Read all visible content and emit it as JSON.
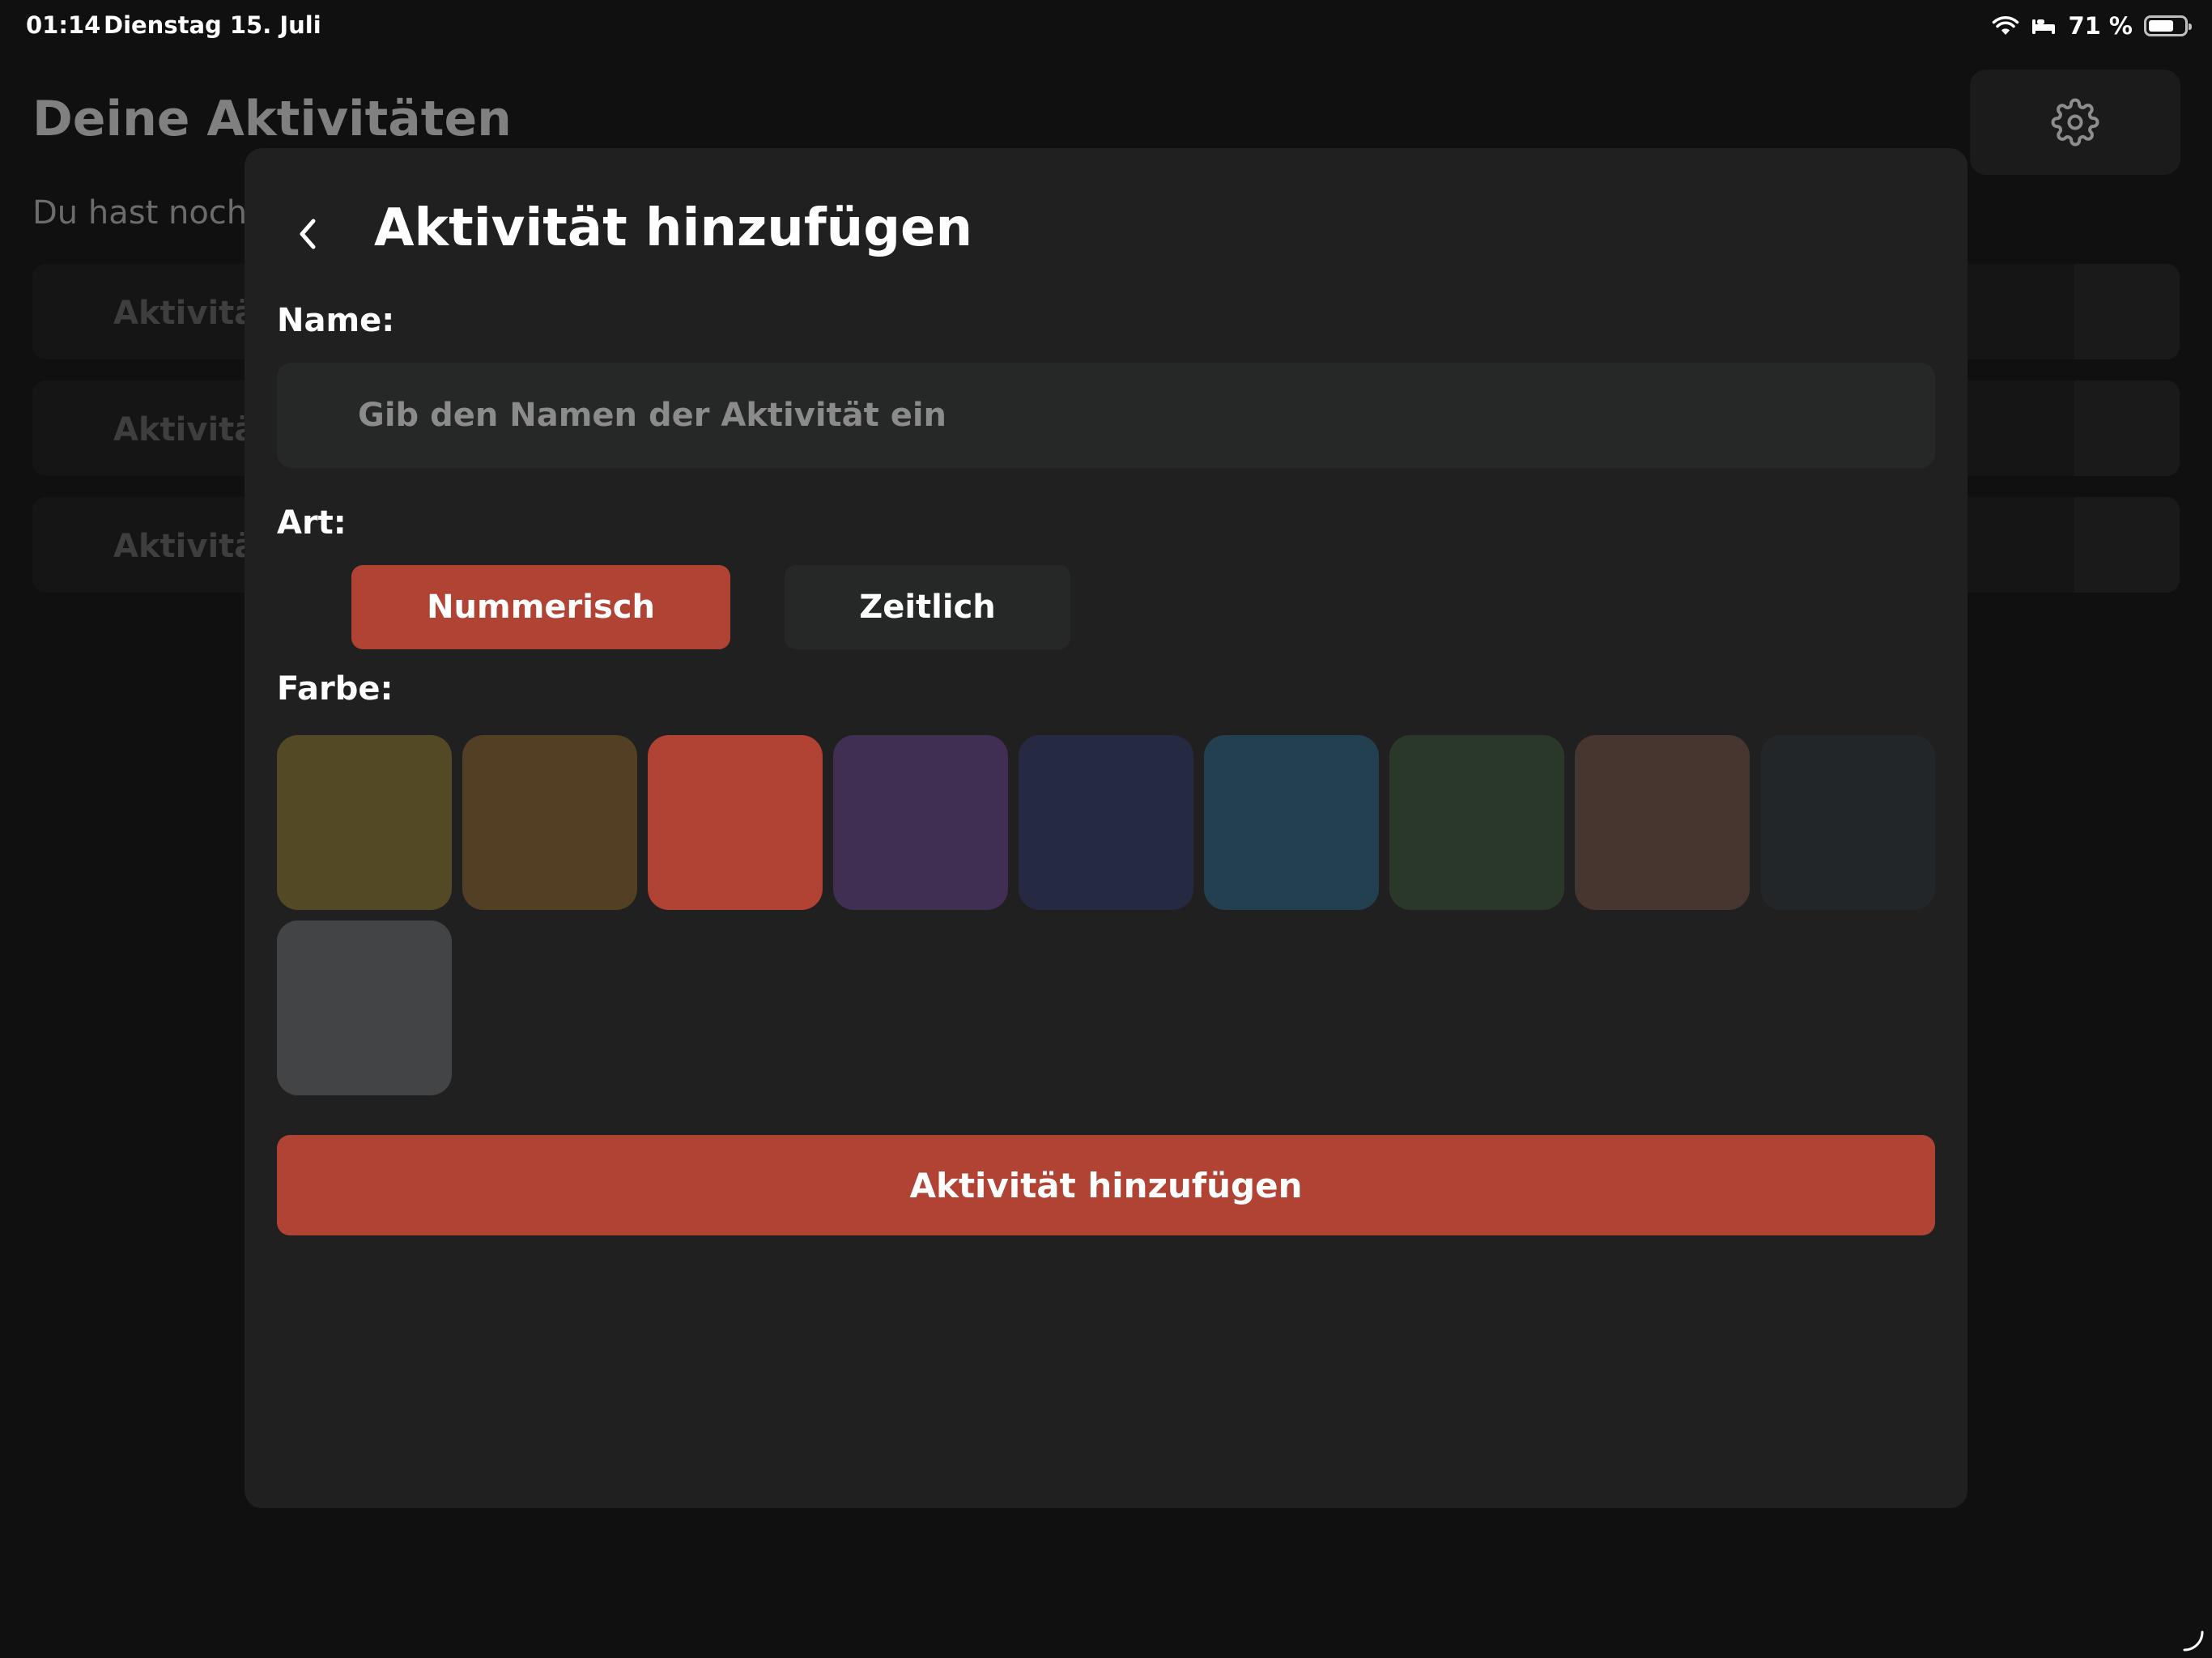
{
  "status_bar": {
    "time": "01:14",
    "date": "Dienstag 15. Juli",
    "battery_text": "71 %",
    "battery_level": 0.71,
    "icons": [
      "wifi-icon",
      "sleep-focus-icon",
      "battery-icon"
    ]
  },
  "background": {
    "title": "Deine Aktivitäten",
    "subtitle": "Du hast noch",
    "items": [
      {
        "label": "Aktivitä"
      },
      {
        "label": "Aktivitä"
      },
      {
        "label": "Aktivitä"
      }
    ],
    "settings_icon": "gear-icon"
  },
  "modal": {
    "back_icon": "chevron-left-icon",
    "title": "Aktivität hinzufügen",
    "name_label": "Name:",
    "name_placeholder": "Gib den Namen der Aktivität ein",
    "name_value": "",
    "type_label": "Art:",
    "type_options": [
      {
        "label": "Nummerisch",
        "selected": true
      },
      {
        "label": "Zeitlich",
        "selected": false
      }
    ],
    "color_label": "Farbe:",
    "colors": [
      "#534a25",
      "#533f24",
      "#b04333",
      "#412f53",
      "#252a42",
      "#22404f",
      "#293829",
      "#473630",
      "#232628",
      "#434446"
    ],
    "selected_color": "#b04333",
    "submit_label": "Aktivität hinzufügen",
    "accent_color": "#b04333"
  }
}
